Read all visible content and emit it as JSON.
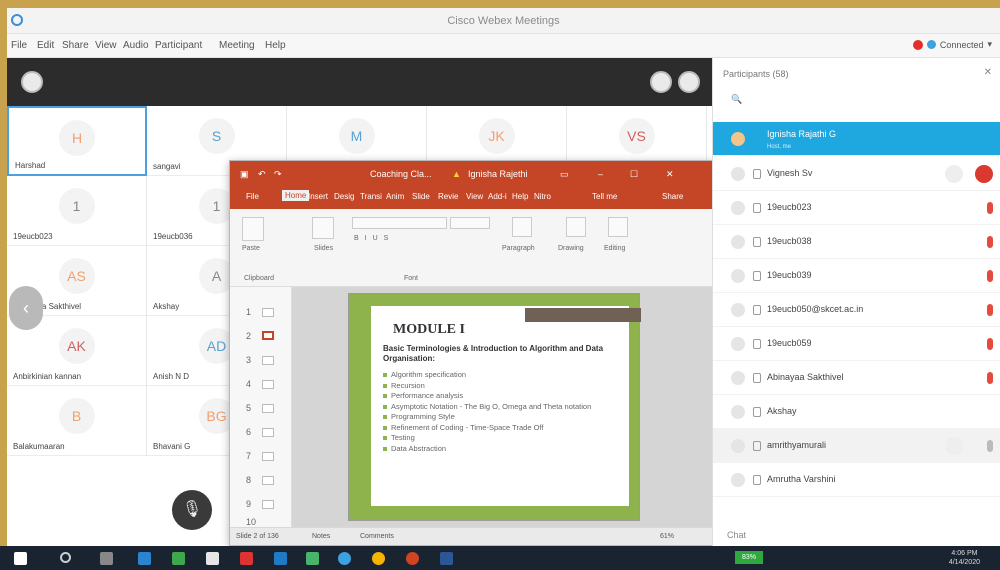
{
  "window": {
    "title": "Cisco Webex Meetings"
  },
  "menu": [
    "File",
    "Edit",
    "Share",
    "View",
    "Audio",
    "Participant",
    "Meeting",
    "Help"
  ],
  "status": {
    "connected": "Connected"
  },
  "tiles": [
    {
      "initials": "H",
      "name": "Harshad"
    },
    {
      "initials": "S",
      "name": "sangavi"
    },
    {
      "initials": "M",
      "name": ""
    },
    {
      "initials": "JK",
      "name": ""
    },
    {
      "initials": "VS",
      "name": ""
    },
    {
      "initials": "1",
      "name": "19eucb023"
    },
    {
      "initials": "1",
      "name": "19eucb036"
    },
    {
      "initials": "AS",
      "name": "Abinayaa Sakthivel"
    },
    {
      "initials": "A",
      "name": "Akshay"
    },
    {
      "initials": "AK",
      "name": "Anbirkinian kannan"
    },
    {
      "initials": "AD",
      "name": "Anish N D"
    },
    {
      "initials": "B",
      "name": "Balakumaaran"
    },
    {
      "initials": "BG",
      "name": "Bhavani G"
    }
  ],
  "ppt": {
    "doc_title": "Coaching Cla...",
    "user": "Ignisha Rajethi",
    "tabs": [
      "File",
      "Home",
      "Insert",
      "Desig",
      "Transi",
      "Anim",
      "Slide",
      "Revie",
      "View",
      "Add-i",
      "Help",
      "Nitro",
      "Tell me",
      "Share"
    ],
    "ribbon": {
      "paste": "Paste",
      "clipboard": "Clipboard",
      "slides": "Slides",
      "font": "Font",
      "paragraph": "Paragraph",
      "drawing": "Drawing",
      "editing": "Editing"
    },
    "thumb_numbers": [
      "1",
      "2",
      "3",
      "4",
      "5",
      "6",
      "7",
      "8",
      "9",
      "10"
    ],
    "slide": {
      "heading": "MODULE I",
      "subtitle": "Basic Terminologies & Introduction to Algorithm and Data Organisation:",
      "bullets": [
        "Algorithm specification",
        "Recursion",
        "Performance analysis",
        "Asymptotic Notation - The Big O, Omega and Theta notation",
        "Programming Style",
        "Refinement of Coding - Time-Space Trade Off",
        "Testing",
        "Data Abstraction"
      ]
    },
    "status": {
      "slide": "Slide 2 of 136",
      "notes": "Notes",
      "comments": "Comments",
      "zoom": "61%"
    }
  },
  "participants": {
    "header": "Participants (58)",
    "list": [
      {
        "name": "Ignisha Rajathi G",
        "sub": "Host, me"
      },
      {
        "name": "Vignesh Sv"
      },
      {
        "name": "19eucb023"
      },
      {
        "name": "19eucb038"
      },
      {
        "name": "19eucb039"
      },
      {
        "name": "19eucb050@skcet.ac.in"
      },
      {
        "name": "19eucb059"
      },
      {
        "name": "Abinayaa Sakthivel"
      },
      {
        "name": "Akshay"
      },
      {
        "name": "amrithyamurali"
      },
      {
        "name": "Amrutha Varshini"
      }
    ],
    "chat": "Chat"
  },
  "taskbar": {
    "battery": "83%",
    "time": "4:06 PM",
    "date": "4/14/2020"
  }
}
